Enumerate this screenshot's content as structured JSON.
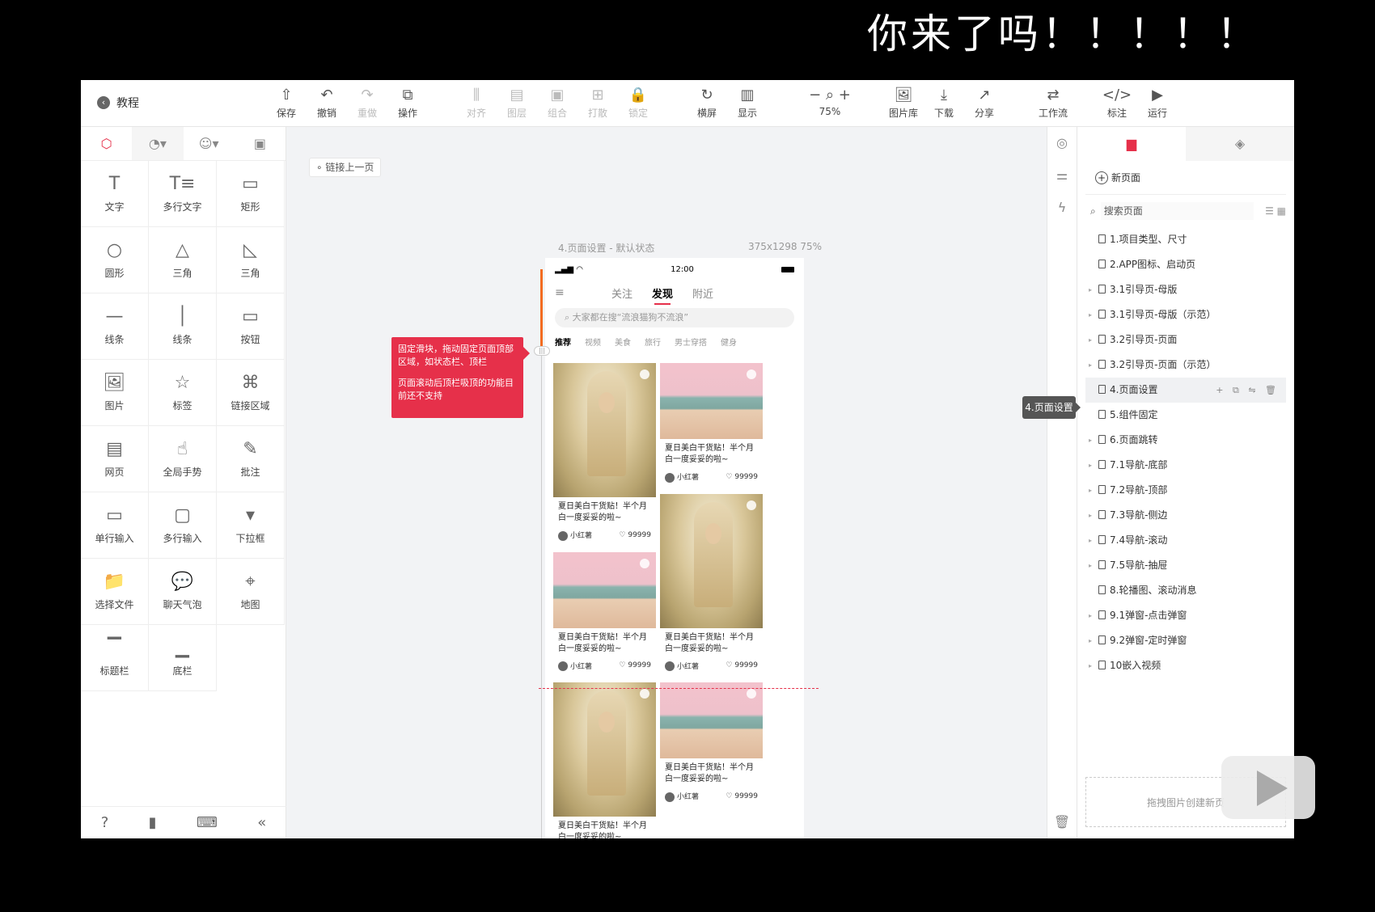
{
  "caption": "你来了吗！！！！！",
  "header": {
    "back_label": "教程"
  },
  "toolbar": [
    {
      "label": "保存",
      "icon": "cloud-upload-icon",
      "enabled": true
    },
    {
      "label": "撤销",
      "icon": "undo-icon",
      "enabled": true
    },
    {
      "label": "重做",
      "icon": "redo-icon",
      "enabled": false
    },
    {
      "label": "操作",
      "icon": "copy-icon",
      "enabled": true
    },
    {
      "label": "对齐",
      "icon": "align-icon",
      "enabled": false
    },
    {
      "label": "图层",
      "icon": "layer-icon",
      "enabled": false
    },
    {
      "label": "组合",
      "icon": "group-icon",
      "enabled": false
    },
    {
      "label": "打散",
      "icon": "ungroup-icon",
      "enabled": false
    },
    {
      "label": "锁定",
      "icon": "lock-icon",
      "enabled": false
    },
    {
      "label": "横屏",
      "icon": "rotate-icon",
      "enabled": true
    },
    {
      "label": "显示",
      "icon": "display-icon",
      "enabled": true
    },
    {
      "label": "75%",
      "icon": "zoom-icon",
      "enabled": true
    },
    {
      "label": "图片库",
      "icon": "image-library-icon",
      "enabled": true
    },
    {
      "label": "下载",
      "icon": "download-icon",
      "enabled": true
    },
    {
      "label": "分享",
      "icon": "share-icon",
      "enabled": true
    },
    {
      "label": "工作流",
      "icon": "workflow-icon",
      "enabled": true
    },
    {
      "label": "标注",
      "icon": "code-icon",
      "enabled": true
    },
    {
      "label": "运行",
      "icon": "play-icon",
      "enabled": true
    }
  ],
  "components": [
    {
      "label": "文字",
      "icon": "T"
    },
    {
      "label": "多行文字",
      "icon": "T≡"
    },
    {
      "label": "矩形",
      "icon": "▭"
    },
    {
      "label": "圆形",
      "icon": "○"
    },
    {
      "label": "三角",
      "icon": "△"
    },
    {
      "label": "三角",
      "icon": "◺"
    },
    {
      "label": "线条",
      "icon": "—"
    },
    {
      "label": "线条",
      "icon": "│"
    },
    {
      "label": "按钮",
      "icon": "▭"
    },
    {
      "label": "图片",
      "icon": "🖼"
    },
    {
      "label": "标签",
      "icon": "☆"
    },
    {
      "label": "链接区域",
      "icon": "⌘"
    },
    {
      "label": "网页",
      "icon": "▤"
    },
    {
      "label": "全局手势",
      "icon": "☝"
    },
    {
      "label": "批注",
      "icon": "✎"
    },
    {
      "label": "单行输入",
      "icon": "▭"
    },
    {
      "label": "多行输入",
      "icon": "▢"
    },
    {
      "label": "下拉框",
      "icon": "▾"
    },
    {
      "label": "选择文件",
      "icon": "📁"
    },
    {
      "label": "聊天气泡",
      "icon": "💬"
    },
    {
      "label": "地图",
      "icon": "⌖"
    },
    {
      "label": "标题栏",
      "icon": "▔"
    },
    {
      "label": "底栏",
      "icon": "▁"
    }
  ],
  "canvas": {
    "prev_link": "链接上一页",
    "frame_label": "4.页面设置 - 默认状态",
    "frame_size": "375x1298 75%",
    "tip_line1": "固定滑块，拖动固定页面顶部区域，如状态栏、顶栏",
    "tip_line2": "页面滚动后顶栏吸顶的功能目前还不支持"
  },
  "phone": {
    "time": "12:00",
    "tabs": [
      "关注",
      "发现",
      "附近"
    ],
    "active_tab": "发现",
    "search_placeholder": "大家都在搜“流浪猫狗不流浪”",
    "categories": [
      "推荐",
      "视频",
      "美食",
      "旅行",
      "男士穿搭",
      "健身"
    ],
    "card_title": "夏日美白干货贴！半个月白一度妥妥的啦~",
    "author": "小红薯",
    "likes": "99999"
  },
  "right_panel": {
    "new_page": "新页面",
    "search_placeholder": "搜索页面",
    "selected_tooltip": "4.页面设置",
    "drop_hint": "拖拽图片创建新页",
    "pages": [
      {
        "name": "1.项目类型、尺寸",
        "expandable": false
      },
      {
        "name": "2.APP图标、启动页",
        "expandable": false
      },
      {
        "name": "3.1引导页-母版",
        "expandable": true
      },
      {
        "name": "3.1引导页-母版（示范）",
        "expandable": true
      },
      {
        "name": "3.2引导页-页面",
        "expandable": true
      },
      {
        "name": "3.2引导页-页面（示范）",
        "expandable": true
      },
      {
        "name": "4.页面设置",
        "expandable": false,
        "selected": true
      },
      {
        "name": "5.组件固定",
        "expandable": false
      },
      {
        "name": "6.页面跳转",
        "expandable": true
      },
      {
        "name": "7.1导航-底部",
        "expandable": true
      },
      {
        "name": "7.2导航-顶部",
        "expandable": true
      },
      {
        "name": "7.3导航-侧边",
        "expandable": true
      },
      {
        "name": "7.4导航-滚动",
        "expandable": true
      },
      {
        "name": "7.5导航-抽屉",
        "expandable": true
      },
      {
        "name": "8.轮播图、滚动消息",
        "expandable": false
      },
      {
        "name": "9.1弹窗-点击弹窗",
        "expandable": true
      },
      {
        "name": "9.2弹窗-定时弹窗",
        "expandable": true
      },
      {
        "name": "10嵌入视频",
        "expandable": true
      }
    ]
  },
  "colors": {
    "accent": "#e6304a",
    "fixed_line": "#f36c21"
  }
}
